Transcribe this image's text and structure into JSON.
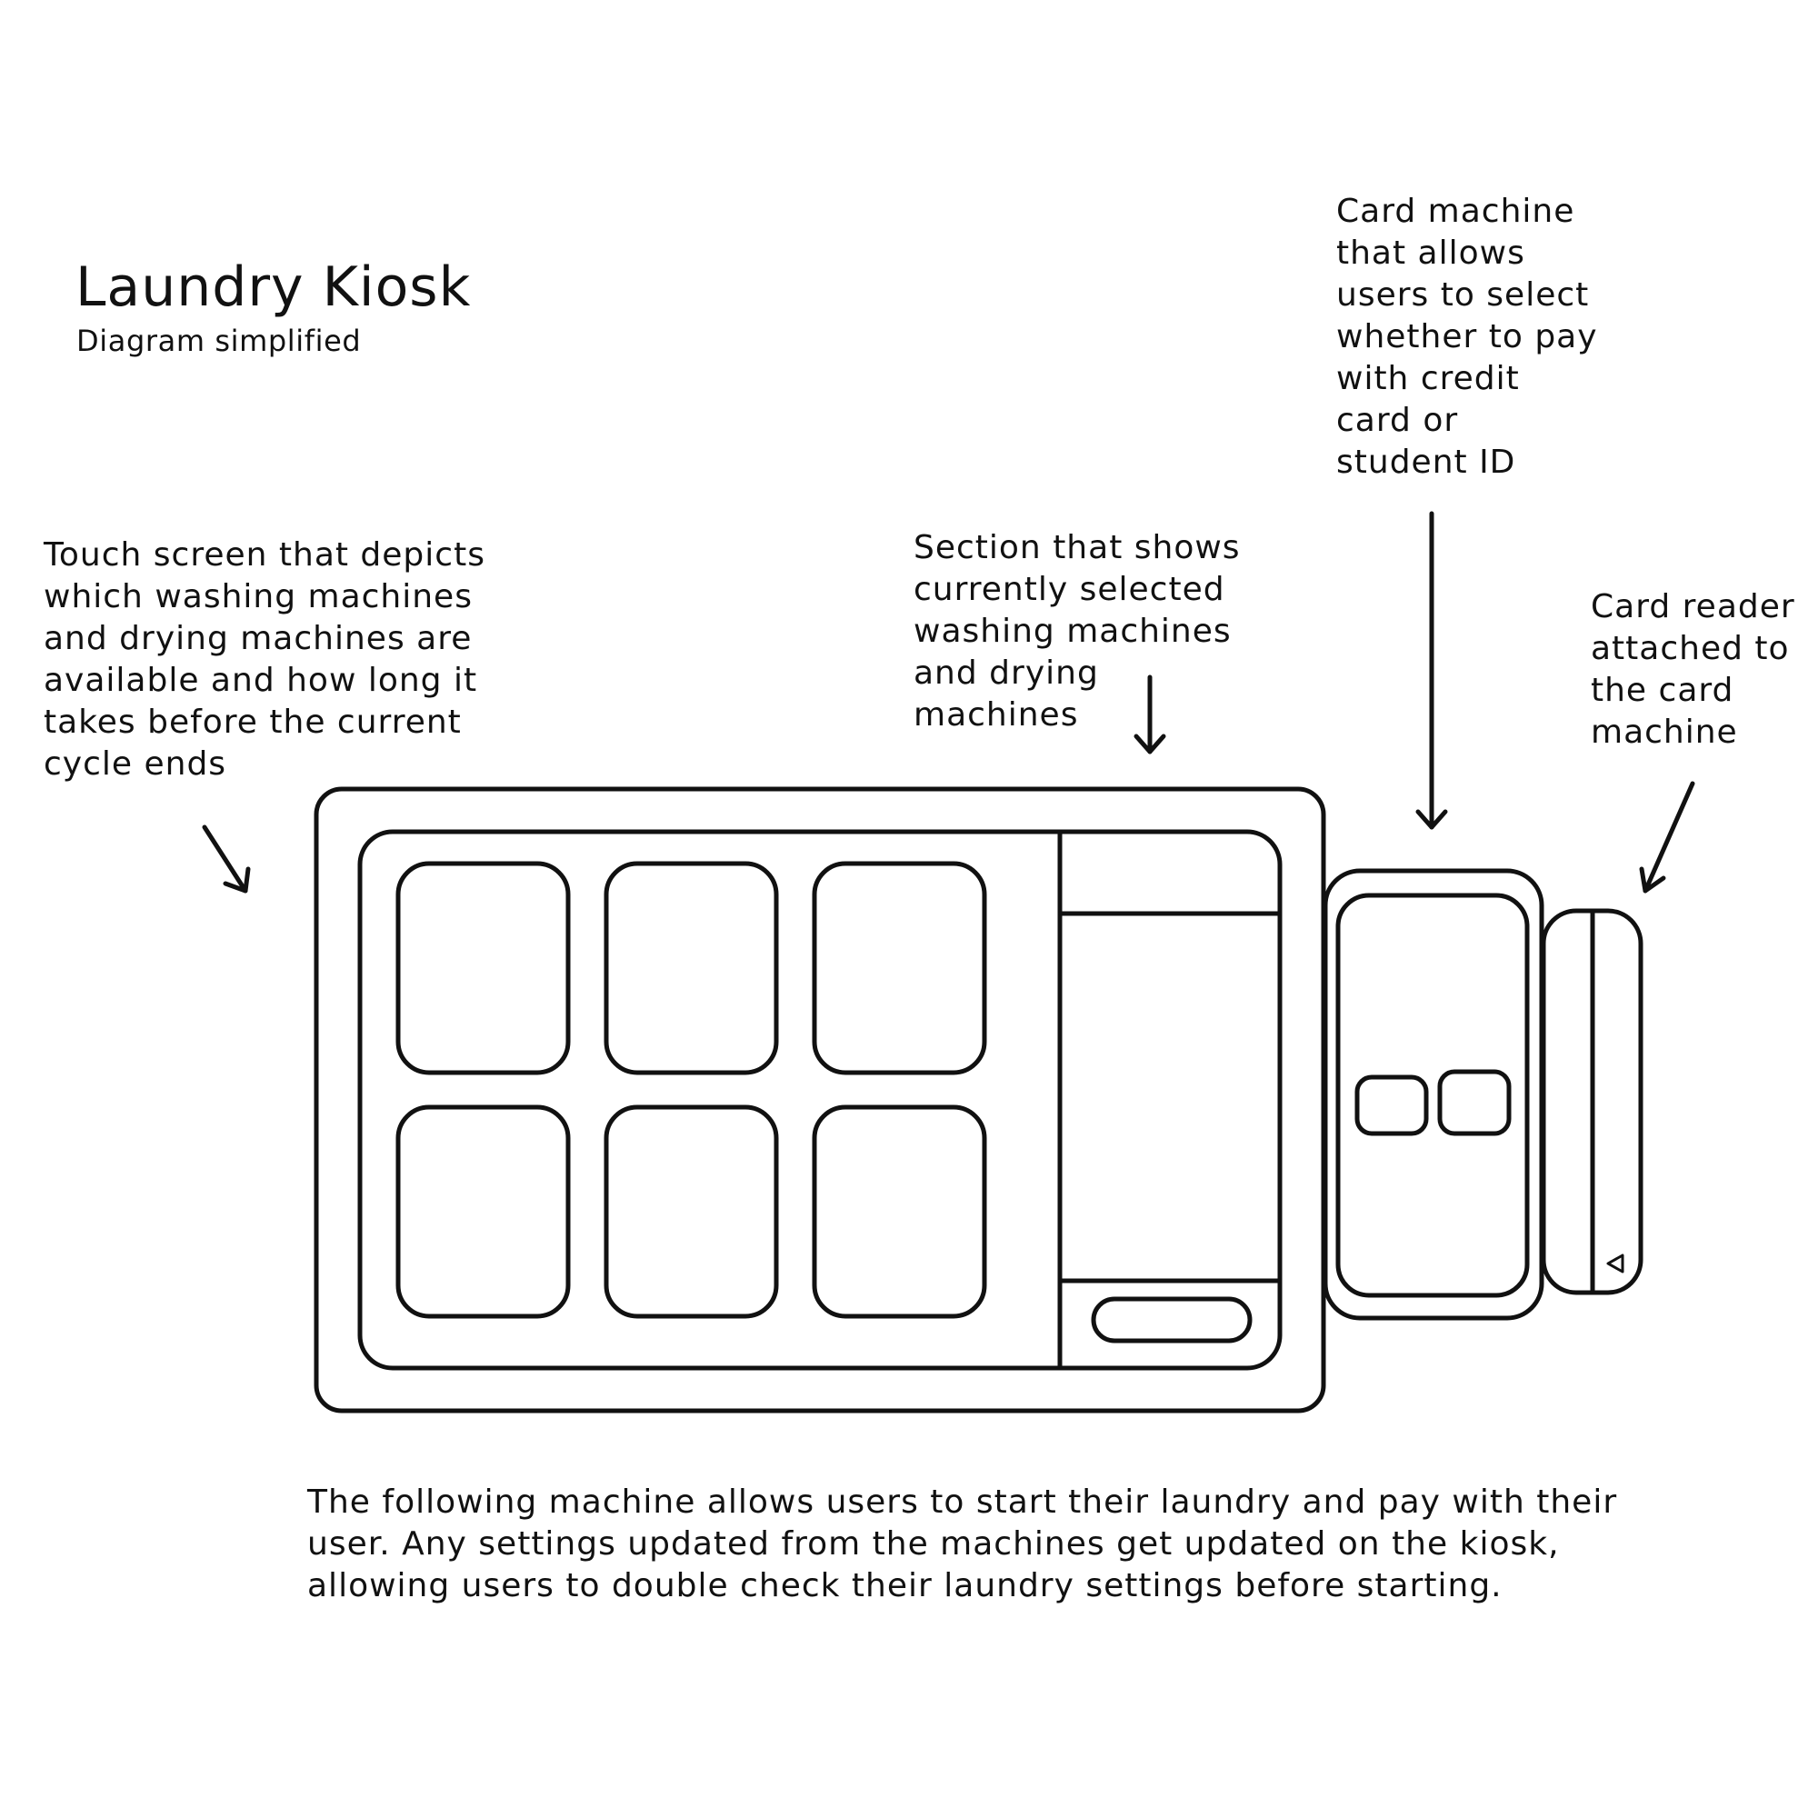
{
  "title": "Laundry Kiosk",
  "subtitle": "Diagram simplified",
  "annotations": {
    "touch_screen": "Touch screen that depicts\nwhich washing machines\nand drying machines are\navailable and how long it\ntakes before the current\ncycle ends",
    "selected_section": "Section that shows\ncurrently selected\nwashing machines\nand drying\nmachines",
    "card_machine": "Card machine\nthat allows\nusers to select\nwhether to pay\nwith credit\ncard or\nstudent ID",
    "card_reader": "Card reader\nattached to\nthe card\nmachine"
  },
  "caption": "The following machine allows users to start their laundry and pay with their\nuser. Any settings updated from the machines get updated on the kiosk,\nallowing users to double check their laundry settings before starting.",
  "colors": {
    "stroke": "#111111",
    "background": "#ffffff"
  },
  "icons": {
    "card_slot_marker": "triangle-left-icon"
  }
}
